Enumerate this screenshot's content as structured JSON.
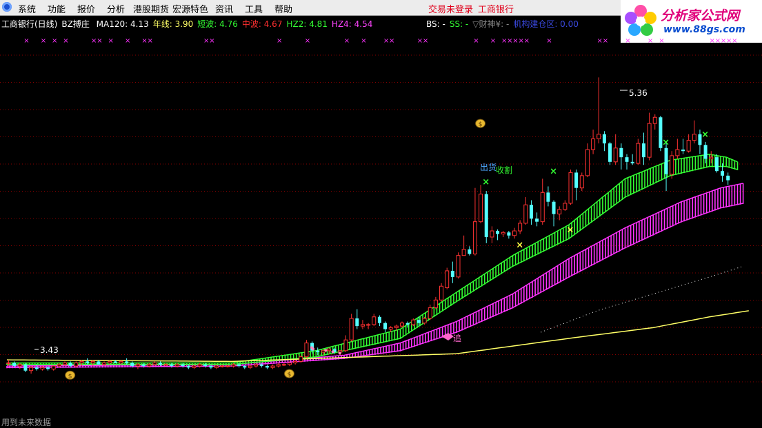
{
  "menu": {
    "items": [
      "系统",
      "功能",
      "报价",
      "分析",
      "港股期货",
      "宏源特色",
      "资讯",
      "工具",
      "帮助"
    ],
    "login_status": "交易未登录",
    "bank_link": "工商银行"
  },
  "logo": {
    "title": "分析家公式网",
    "url": "www.88gs.com"
  },
  "indicators": {
    "stock_title": "工商银行(日线)",
    "formula_name": "BZ搏庄",
    "items": [
      {
        "text": "MA120: 4.13",
        "color": "#ffffff"
      },
      {
        "text": "年线: 3.90",
        "color": "#ffff66"
      },
      {
        "text": "短波: 4.76",
        "color": "#33ff33"
      },
      {
        "text": "中波: 4.67",
        "color": "#ff3030"
      },
      {
        "text": "HZ2: 4.81",
        "color": "#33ff33"
      },
      {
        "text": "HZ4: 4.54",
        "color": "#ff44ff"
      }
    ],
    "right": [
      {
        "text": "BS: -",
        "color": "#ffffff"
      },
      {
        "text": "SS: -",
        "color": "#33ff33"
      },
      {
        "text": "▽财神¥: -",
        "color": "#888888"
      },
      {
        "text": "机构建仓区: 0.00",
        "color": "#3a49e0"
      }
    ]
  },
  "annotations": {
    "high_label": "5.36",
    "low_label": "3.43",
    "sell_label": "出货",
    "harvest_label": "收割",
    "chase_label": "追",
    "cross_symbol": "×",
    "bag_symbol": "$"
  },
  "footer_note": "用到未来数据",
  "colors": {
    "up": "#ff3232",
    "down": "#54ffff",
    "short_band": "#33ff33",
    "mid_band": "#ff33ff",
    "ma120": "#ffffff",
    "year_line": "#ffff66",
    "grid": "#8b0000",
    "magenta_x": "#ff33ff"
  },
  "chart_data": {
    "type": "candlestick",
    "ylim": [
      3.35,
      5.55
    ],
    "grid": true,
    "x_range": [
      0,
      133
    ],
    "top_marks": [
      3,
      6,
      8,
      10,
      15,
      16,
      18,
      21,
      24,
      25,
      35,
      36,
      48,
      53,
      60,
      63,
      67,
      68,
      73,
      74,
      83,
      86,
      88,
      89,
      90,
      91,
      92,
      96,
      105,
      106,
      110,
      114,
      116,
      125,
      126,
      127,
      128,
      129
    ],
    "ohlc": [
      [
        3.5,
        3.52,
        3.48,
        3.5
      ],
      [
        3.5,
        3.51,
        3.47,
        3.48
      ],
      [
        3.48,
        3.5,
        3.46,
        3.49
      ],
      [
        3.49,
        3.5,
        3.44,
        3.45
      ],
      [
        3.45,
        3.48,
        3.43,
        3.47
      ],
      [
        3.47,
        3.49,
        3.45,
        3.46
      ],
      [
        3.46,
        3.48,
        3.45,
        3.47
      ],
      [
        3.47,
        3.48,
        3.45,
        3.46
      ],
      [
        3.46,
        3.48,
        3.45,
        3.48
      ],
      [
        3.48,
        3.5,
        3.47,
        3.49
      ],
      [
        3.49,
        3.51,
        3.48,
        3.5
      ],
      [
        3.5,
        3.51,
        3.47,
        3.48
      ],
      [
        3.48,
        3.51,
        3.47,
        3.5
      ],
      [
        3.5,
        3.52,
        3.48,
        3.51
      ],
      [
        3.51,
        3.53,
        3.49,
        3.5
      ],
      [
        3.5,
        3.52,
        3.48,
        3.51
      ],
      [
        3.51,
        3.52,
        3.49,
        3.49
      ],
      [
        3.49,
        3.51,
        3.48,
        3.5
      ],
      [
        3.5,
        3.52,
        3.49,
        3.51
      ],
      [
        3.51,
        3.52,
        3.5,
        3.5
      ],
      [
        3.5,
        3.52,
        3.49,
        3.51
      ],
      [
        3.51,
        3.53,
        3.49,
        3.5
      ],
      [
        3.5,
        3.51,
        3.47,
        3.48
      ],
      [
        3.48,
        3.5,
        3.46,
        3.49
      ],
      [
        3.49,
        3.5,
        3.47,
        3.48
      ],
      [
        3.48,
        3.5,
        3.47,
        3.49
      ],
      [
        3.49,
        3.51,
        3.48,
        3.5
      ],
      [
        3.5,
        3.51,
        3.48,
        3.49
      ],
      [
        3.49,
        3.5,
        3.48,
        3.49
      ],
      [
        3.49,
        3.5,
        3.47,
        3.48
      ],
      [
        3.48,
        3.5,
        3.47,
        3.49
      ],
      [
        3.49,
        3.5,
        3.47,
        3.48
      ],
      [
        3.48,
        3.49,
        3.46,
        3.47
      ],
      [
        3.47,
        3.49,
        3.46,
        3.48
      ],
      [
        3.48,
        3.5,
        3.47,
        3.49
      ],
      [
        3.49,
        3.5,
        3.47,
        3.48
      ],
      [
        3.48,
        3.49,
        3.46,
        3.47
      ],
      [
        3.47,
        3.49,
        3.46,
        3.48
      ],
      [
        3.48,
        3.49,
        3.47,
        3.48
      ],
      [
        3.48,
        3.49,
        3.47,
        3.48
      ],
      [
        3.48,
        3.5,
        3.47,
        3.49
      ],
      [
        3.49,
        3.5,
        3.47,
        3.48
      ],
      [
        3.48,
        3.49,
        3.46,
        3.47
      ],
      [
        3.47,
        3.49,
        3.46,
        3.48
      ],
      [
        3.48,
        3.5,
        3.47,
        3.49
      ],
      [
        3.49,
        3.5,
        3.47,
        3.48
      ],
      [
        3.48,
        3.49,
        3.46,
        3.47
      ],
      [
        3.47,
        3.49,
        3.46,
        3.48
      ],
      [
        3.48,
        3.5,
        3.47,
        3.49
      ],
      [
        3.49,
        3.5,
        3.48,
        3.49
      ],
      [
        3.49,
        3.51,
        3.48,
        3.5
      ],
      [
        3.5,
        3.52,
        3.49,
        3.51
      ],
      [
        3.51,
        3.55,
        3.5,
        3.54
      ],
      [
        3.54,
        3.65,
        3.53,
        3.63
      ],
      [
        3.63,
        3.64,
        3.56,
        3.58
      ],
      [
        3.58,
        3.6,
        3.55,
        3.57
      ],
      [
        3.57,
        3.59,
        3.55,
        3.58
      ],
      [
        3.58,
        3.6,
        3.56,
        3.59
      ],
      [
        3.59,
        3.6,
        3.56,
        3.57
      ],
      [
        3.57,
        3.58,
        3.55,
        3.58
      ],
      [
        3.58,
        3.68,
        3.57,
        3.65
      ],
      [
        3.65,
        3.82,
        3.64,
        3.79
      ],
      [
        3.79,
        3.85,
        3.72,
        3.74
      ],
      [
        3.74,
        3.78,
        3.72,
        3.75
      ],
      [
        3.75,
        3.76,
        3.72,
        3.75
      ],
      [
        3.75,
        3.82,
        3.74,
        3.8
      ],
      [
        3.8,
        3.81,
        3.74,
        3.76
      ],
      [
        3.76,
        3.77,
        3.7,
        3.72
      ],
      [
        3.72,
        3.74,
        3.7,
        3.73
      ],
      [
        3.73,
        3.75,
        3.71,
        3.74
      ],
      [
        3.74,
        3.77,
        3.73,
        3.76
      ],
      [
        3.76,
        3.77,
        3.73,
        3.75
      ],
      [
        3.75,
        3.79,
        3.74,
        3.78
      ],
      [
        3.78,
        3.8,
        3.74,
        3.76
      ],
      [
        3.76,
        3.8,
        3.75,
        3.79
      ],
      [
        3.79,
        3.88,
        3.78,
        3.86
      ],
      [
        3.86,
        3.93,
        3.85,
        3.91
      ],
      [
        3.91,
        4.02,
        3.9,
        4.0
      ],
      [
        3.99,
        4.12,
        3.98,
        4.1
      ],
      [
        4.1,
        4.16,
        4.02,
        4.06
      ],
      [
        4.06,
        4.22,
        4.05,
        4.2
      ],
      [
        4.2,
        4.33,
        4.2,
        4.24
      ],
      [
        4.24,
        4.26,
        4.2,
        4.21
      ],
      [
        4.21,
        4.64,
        4.2,
        4.42
      ],
      [
        4.42,
        4.66,
        4.41,
        4.6
      ],
      [
        4.6,
        4.62,
        4.28,
        4.32
      ],
      [
        4.32,
        4.39,
        4.28,
        4.36
      ],
      [
        4.36,
        4.37,
        4.3,
        4.34
      ],
      [
        4.34,
        4.36,
        4.32,
        4.35
      ],
      [
        4.35,
        4.36,
        4.31,
        4.33
      ],
      [
        4.33,
        4.38,
        4.31,
        4.36
      ],
      [
        4.36,
        4.43,
        4.34,
        4.41
      ],
      [
        4.41,
        4.58,
        4.4,
        4.53
      ],
      [
        4.53,
        4.56,
        4.4,
        4.44
      ],
      [
        4.44,
        4.48,
        4.39,
        4.42
      ],
      [
        4.42,
        4.7,
        4.4,
        4.61
      ],
      [
        4.61,
        4.65,
        4.52,
        4.55
      ],
      [
        4.55,
        4.56,
        4.39,
        4.47
      ],
      [
        4.47,
        4.52,
        4.43,
        4.5
      ],
      [
        4.5,
        4.56,
        4.49,
        4.54
      ],
      [
        4.54,
        4.76,
        4.53,
        4.74
      ],
      [
        4.74,
        4.76,
        4.56,
        4.64
      ],
      [
        4.64,
        4.74,
        4.62,
        4.72
      ],
      [
        4.72,
        4.93,
        4.71,
        4.89
      ],
      [
        4.89,
        5.02,
        4.86,
        4.96
      ],
      [
        4.96,
        5.36,
        4.93,
        4.99
      ],
      [
        4.99,
        5.01,
        4.88,
        4.93
      ],
      [
        4.93,
        4.94,
        4.79,
        4.81
      ],
      [
        4.81,
        4.99,
        4.79,
        4.9
      ],
      [
        4.9,
        4.93,
        4.76,
        4.84
      ],
      [
        4.84,
        4.86,
        4.76,
        4.81
      ],
      [
        4.81,
        4.86,
        4.79,
        4.8
      ],
      [
        4.8,
        4.96,
        4.79,
        4.93
      ],
      [
        4.93,
        5.0,
        4.79,
        4.84
      ],
      [
        4.84,
        5.13,
        4.82,
        5.06
      ],
      [
        5.06,
        5.12,
        5.02,
        5.1
      ],
      [
        5.1,
        5.11,
        4.88,
        4.9
      ],
      [
        4.9,
        4.94,
        4.62,
        4.73
      ],
      [
        4.73,
        4.88,
        4.7,
        4.85
      ],
      [
        4.85,
        4.96,
        4.83,
        4.89
      ],
      [
        4.89,
        4.96,
        4.86,
        4.88
      ],
      [
        4.88,
        4.99,
        4.87,
        4.95
      ],
      [
        4.95,
        5.08,
        4.93,
        4.99
      ],
      [
        4.99,
        5.02,
        4.86,
        4.92
      ],
      [
        4.92,
        4.94,
        4.8,
        4.83
      ],
      [
        4.83,
        4.88,
        4.8,
        4.84
      ],
      [
        4.84,
        4.86,
        4.74,
        4.75
      ],
      [
        4.75,
        4.8,
        4.68,
        4.72
      ],
      [
        4.72,
        4.74,
        4.66,
        4.69
      ]
    ],
    "year_line": [
      [
        0,
        3.52
      ],
      [
        40,
        3.51
      ],
      [
        80,
        3.56
      ],
      [
        100,
        3.66
      ],
      [
        115,
        3.73
      ],
      [
        125,
        3.8
      ],
      [
        132,
        3.84
      ]
    ],
    "ma120": [
      [
        95,
        3.7
      ],
      [
        105,
        3.84
      ],
      [
        115,
        3.95
      ],
      [
        125,
        4.06
      ],
      [
        131,
        4.13
      ]
    ],
    "mid_band": {
      "fast": [
        [
          0,
          3.48
        ],
        [
          40,
          3.49
        ],
        [
          60,
          3.55
        ],
        [
          70,
          3.63
        ],
        [
          80,
          3.77
        ],
        [
          90,
          3.95
        ],
        [
          100,
          4.18
        ],
        [
          110,
          4.38
        ],
        [
          120,
          4.55
        ],
        [
          127,
          4.64
        ],
        [
          131,
          4.67
        ]
      ],
      "slow": [
        [
          0,
          3.47
        ],
        [
          40,
          3.48
        ],
        [
          60,
          3.53
        ],
        [
          70,
          3.58
        ],
        [
          80,
          3.7
        ],
        [
          90,
          3.86
        ],
        [
          100,
          4.06
        ],
        [
          110,
          4.25
        ],
        [
          120,
          4.42
        ],
        [
          127,
          4.51
        ],
        [
          131,
          4.54
        ]
      ]
    },
    "short_band": {
      "fast": [
        [
          0,
          3.5
        ],
        [
          40,
          3.5
        ],
        [
          55,
          3.58
        ],
        [
          70,
          3.72
        ],
        [
          80,
          3.96
        ],
        [
          90,
          4.2
        ],
        [
          100,
          4.4
        ],
        [
          110,
          4.7
        ],
        [
          118,
          4.82
        ],
        [
          125,
          4.86
        ],
        [
          128,
          4.84
        ],
        [
          130,
          4.81
        ]
      ],
      "slow": [
        [
          0,
          3.49
        ],
        [
          40,
          3.49
        ],
        [
          55,
          3.54
        ],
        [
          70,
          3.66
        ],
        [
          80,
          3.9
        ],
        [
          90,
          4.13
        ],
        [
          100,
          4.31
        ],
        [
          110,
          4.58
        ],
        [
          118,
          4.72
        ],
        [
          125,
          4.78
        ],
        [
          128,
          4.78
        ],
        [
          130,
          4.76
        ]
      ]
    },
    "cross_marks": [
      {
        "x": 85,
        "y": 4.66,
        "color": "#33ff33"
      },
      {
        "x": 97,
        "y": 4.73,
        "color": "#33ff33"
      },
      {
        "x": 117,
        "y": 4.92,
        "color": "#33ff33"
      },
      {
        "x": 124,
        "y": 4.97,
        "color": "#33ff33"
      },
      {
        "x": 91,
        "y": 4.25,
        "color": "#ffff44"
      },
      {
        "x": 100,
        "y": 4.35,
        "color": "#ffff44"
      }
    ],
    "bag_marks": [
      {
        "x": 11,
        "y": 3.42
      },
      {
        "x": 50,
        "y": 3.43
      },
      {
        "x": 84,
        "y": 5.06
      }
    ],
    "pink_marks": [
      54,
      54,
      56,
      57,
      58
    ]
  }
}
